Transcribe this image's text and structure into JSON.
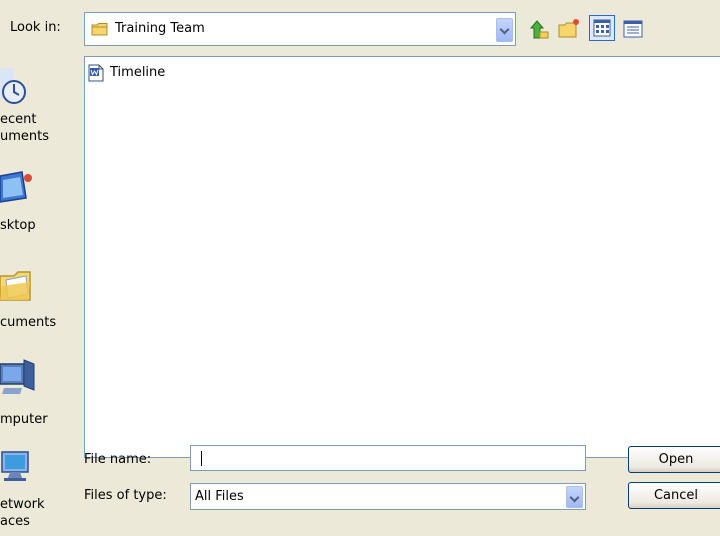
{
  "dialog": {
    "look_in_label": "Look in:",
    "look_in_value": "Training Team",
    "toolbar": {
      "icons": [
        "up-one-level-icon",
        "create-new-folder-icon",
        "views-menu-icon",
        "tools-icon"
      ]
    },
    "places": [
      {
        "label": "ecent\numents",
        "icon": "recent-documents-icon"
      },
      {
        "label": "sktop",
        "icon": "desktop-icon"
      },
      {
        "label": "cuments",
        "icon": "my-documents-icon"
      },
      {
        "label": "mputer",
        "icon": "my-computer-icon"
      },
      {
        "label": "etwork\naces",
        "icon": "network-places-icon"
      }
    ],
    "files": [
      {
        "name": "Timeline",
        "icon": "word-document-icon"
      }
    ],
    "file_name_label": "File name:",
    "file_name_value": "",
    "files_of_type_label": "Files of type:",
    "files_of_type_value": "All Files",
    "open_label": "Open",
    "cancel_label": "Cancel"
  },
  "colors": {
    "dialog_bg": "#ece9d8",
    "field_border": "#7f9db9",
    "button_border": "#003c74"
  }
}
